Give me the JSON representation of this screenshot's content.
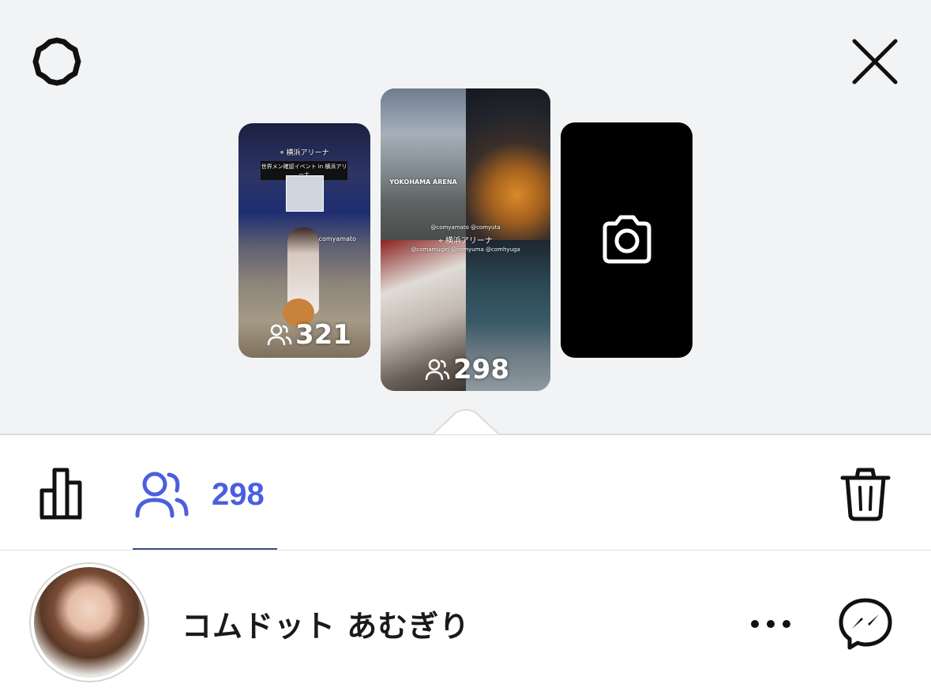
{
  "colors": {
    "accent": "#4a5fe0",
    "top_background": "#f2f3f5",
    "text": "#1a1a1a"
  },
  "header": {
    "settings_icon": "gear-icon",
    "close_icon": "close-icon"
  },
  "stories": [
    {
      "location": "横浜アリーナ",
      "caption": "世界メン確認イベント in 横浜アリーナ",
      "tag": "@comyamato",
      "viewers": "321"
    },
    {
      "location": "横浜アリーナ",
      "venue_sign": "YOKOHAMA ARENA",
      "tags": "@comyamato @comyuta",
      "tags2": "@comamugiri @comyuma @comhyuga",
      "viewers": "298"
    },
    {
      "type": "add-story",
      "icon": "camera-icon"
    }
  ],
  "toolbar": {
    "stats_icon": "bar-chart-icon",
    "viewers_icon": "people-icon",
    "viewers_count": "298",
    "delete_icon": "trash-icon"
  },
  "viewer": {
    "name": "コムドット あむぎり",
    "more_icon": "more-icon",
    "message_icon": "messenger-icon"
  }
}
